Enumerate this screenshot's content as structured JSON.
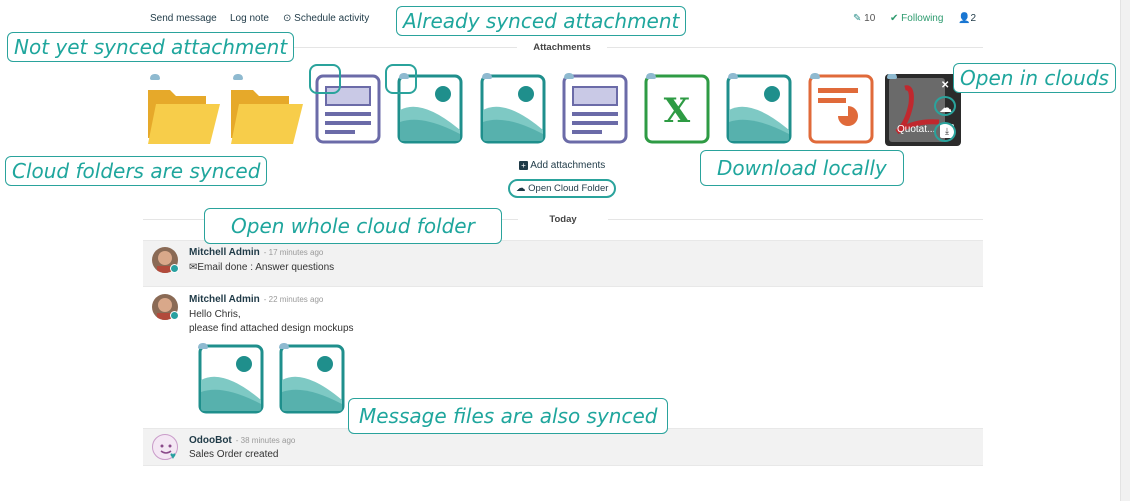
{
  "topbar": {
    "send_message": "Send message",
    "log_note": "Log note",
    "schedule_activity": "Schedule activity",
    "attachments_count": "10",
    "following": "Following",
    "followers_count": "2"
  },
  "attachments": {
    "title": "Attachments",
    "quotation_label": "Quotat...",
    "add_attachments": "Add attachments",
    "open_cloud_folder": "Open Cloud Folder"
  },
  "separator": {
    "today": "Today"
  },
  "messages": [
    {
      "author": "Mitchell Admin",
      "time": "- 17 minutes ago",
      "text": "Email done : Answer questions"
    },
    {
      "author": "Mitchell Admin",
      "time": "- 22 minutes ago",
      "line1": "Hello Chris,",
      "line2": "please find attached design mockups"
    },
    {
      "author": "OdooBot",
      "time": "- 38 minutes ago",
      "text": "Sales Order created"
    }
  ],
  "callouts": {
    "already_synced": "Already synced attachment",
    "not_synced": "Not yet synced attachment",
    "cloud_folders": "Cloud folders are synced",
    "open_clouds": "Open in clouds",
    "download_locally": "Download locally",
    "open_whole_folder": "Open whole cloud folder",
    "message_files": "Message files are also synced"
  },
  "colors": {
    "accent": "#2aa39c",
    "image_icon": "#1f8f8c",
    "excel": "#2e9b44",
    "ppt": "#e06a3a",
    "doc": "#6b6ba8",
    "folder": "#f5c542"
  }
}
